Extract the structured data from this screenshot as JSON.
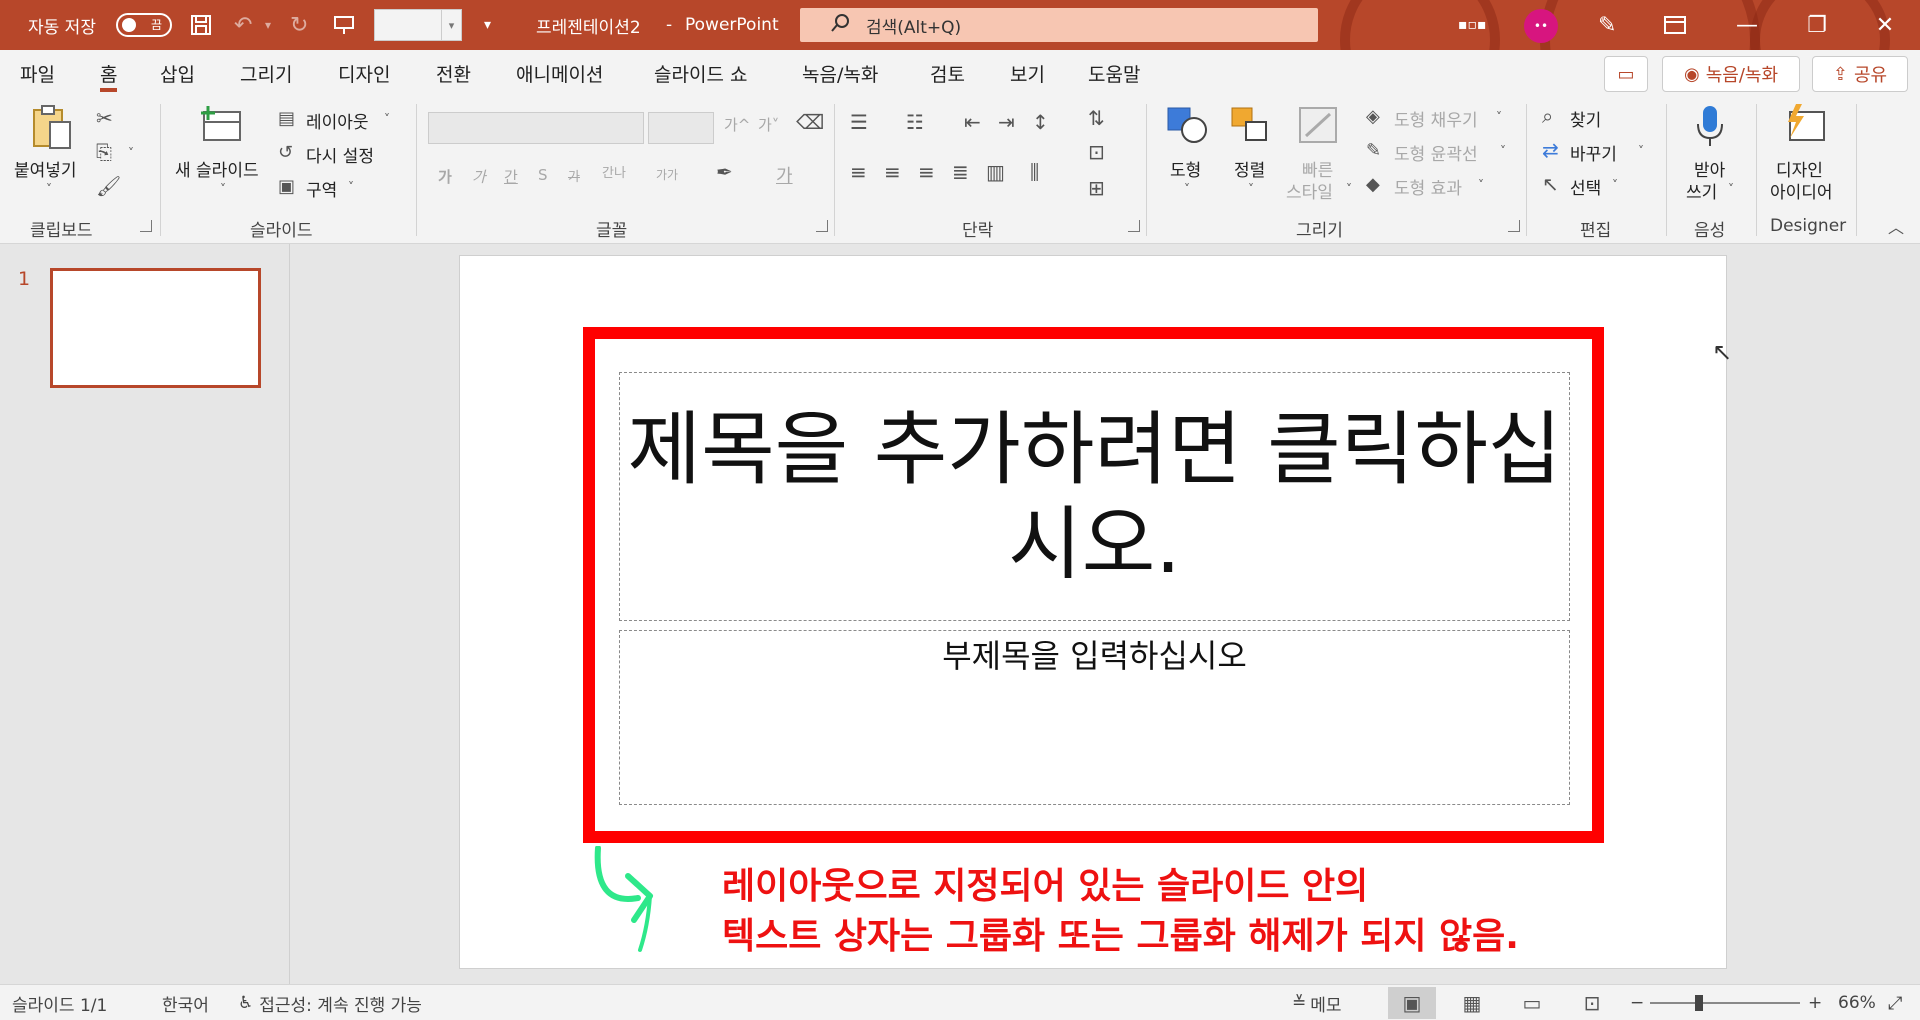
{
  "titlebar": {
    "autosave_label": "자동 저장",
    "autosave_state": "끔",
    "doc_title": "프레젠테이션2",
    "title_sep": "-",
    "app_name": "PowerPoint",
    "search_placeholder": "검색(Alt+Q)",
    "avatar_initials": "••"
  },
  "menu": {
    "tabs": [
      "파일",
      "홈",
      "삽입",
      "그리기",
      "디자인",
      "전환",
      "애니메이션",
      "슬라이드 쇼",
      "녹음/녹화",
      "검토",
      "보기",
      "도움말"
    ],
    "active_tab": "홈",
    "record_button": "녹음/녹화",
    "share_button": "공유"
  },
  "ribbon": {
    "clipboard": {
      "paste": "붙여넣기",
      "group": "클립보드"
    },
    "slides": {
      "new_slide": "새 슬라이드",
      "layout": "레이아웃",
      "reset": "다시 설정",
      "section": "구역",
      "group": "슬라이드"
    },
    "font": {
      "group": "글꼴",
      "grow": "가^",
      "shrink": "가˅",
      "bold": "가",
      "italic": "가",
      "underline": "간",
      "strike": "S",
      "strikethrough_label": "가",
      "spacing": "간나",
      "case": "가가",
      "font_color": "가"
    },
    "paragraph": {
      "group": "단락"
    },
    "drawing": {
      "shapes": "도형",
      "arrange": "정렬",
      "quick_styles_1": "빠른",
      "quick_styles_2": "스타일",
      "fill": "도형 채우기",
      "outline": "도형 윤곽선",
      "effects": "도형 효과",
      "group": "그리기"
    },
    "editing": {
      "find": "찾기",
      "replace": "바꾸기",
      "select": "선택",
      "group": "편집"
    },
    "voice": {
      "dictate_1": "받아",
      "dictate_2": "쓰기",
      "group": "음성"
    },
    "designer": {
      "ideas_1": "디자인",
      "ideas_2": "아이디어",
      "group": "Designer"
    }
  },
  "thumbnails": {
    "slide_number": "1"
  },
  "slide": {
    "title_placeholder": "제목을 추가하려면 클릭하십시오.",
    "subtitle_placeholder": "부제목을 입력하십시오"
  },
  "annotation": {
    "line1": "레이아웃으로 지정되어 있는 슬라이드 안의",
    "line2": "텍스트 상자는 그룹화 또는 그룹화 해제가 되지 않음.",
    "text_color": "#ee1111",
    "frame_color": "#ff0000",
    "arrow_color": "#2ee88a"
  },
  "statusbar": {
    "slide_info": "슬라이드 1/1",
    "language": "한국어",
    "accessibility": "접근성: 계속 진행 가능",
    "notes": "메모",
    "zoom_minus": "−",
    "zoom_plus": "+",
    "zoom": "66%"
  },
  "colors": {
    "accent": "#b7472a"
  }
}
